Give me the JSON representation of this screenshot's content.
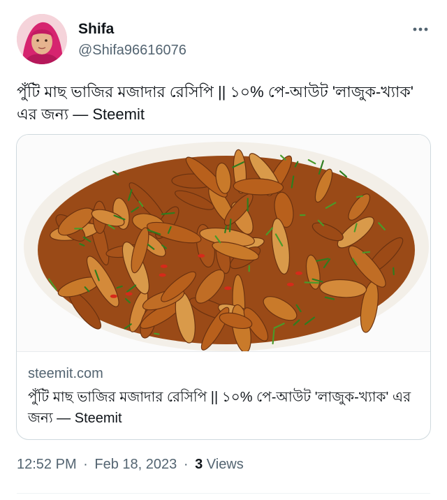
{
  "author": {
    "name": "Shifa",
    "handle": "@Shifa96616076"
  },
  "tweet": {
    "text": "পুঁটি মাছ ভাজির মজাদার রেসিপি || ১০% পে-আউট 'লাজুক-খ্যাক' এর জন্য — Steemit"
  },
  "card": {
    "domain": "steemit.com",
    "title": "পুঁটি মাছ ভাজির মজাদার রেসিপি || ১০% পে-আউট 'লাজুক-খ্যাক' এর জন্য — Steemit"
  },
  "footer": {
    "time": "12:52 PM",
    "separator": "·",
    "date": "Feb 18, 2023",
    "views_count": "3",
    "views_label": "Views"
  },
  "colors": {
    "text_primary": "#0f1419",
    "text_secondary": "#536471",
    "border": "#cfd9de"
  },
  "icons": {
    "more": "more-horizontal-icon"
  }
}
